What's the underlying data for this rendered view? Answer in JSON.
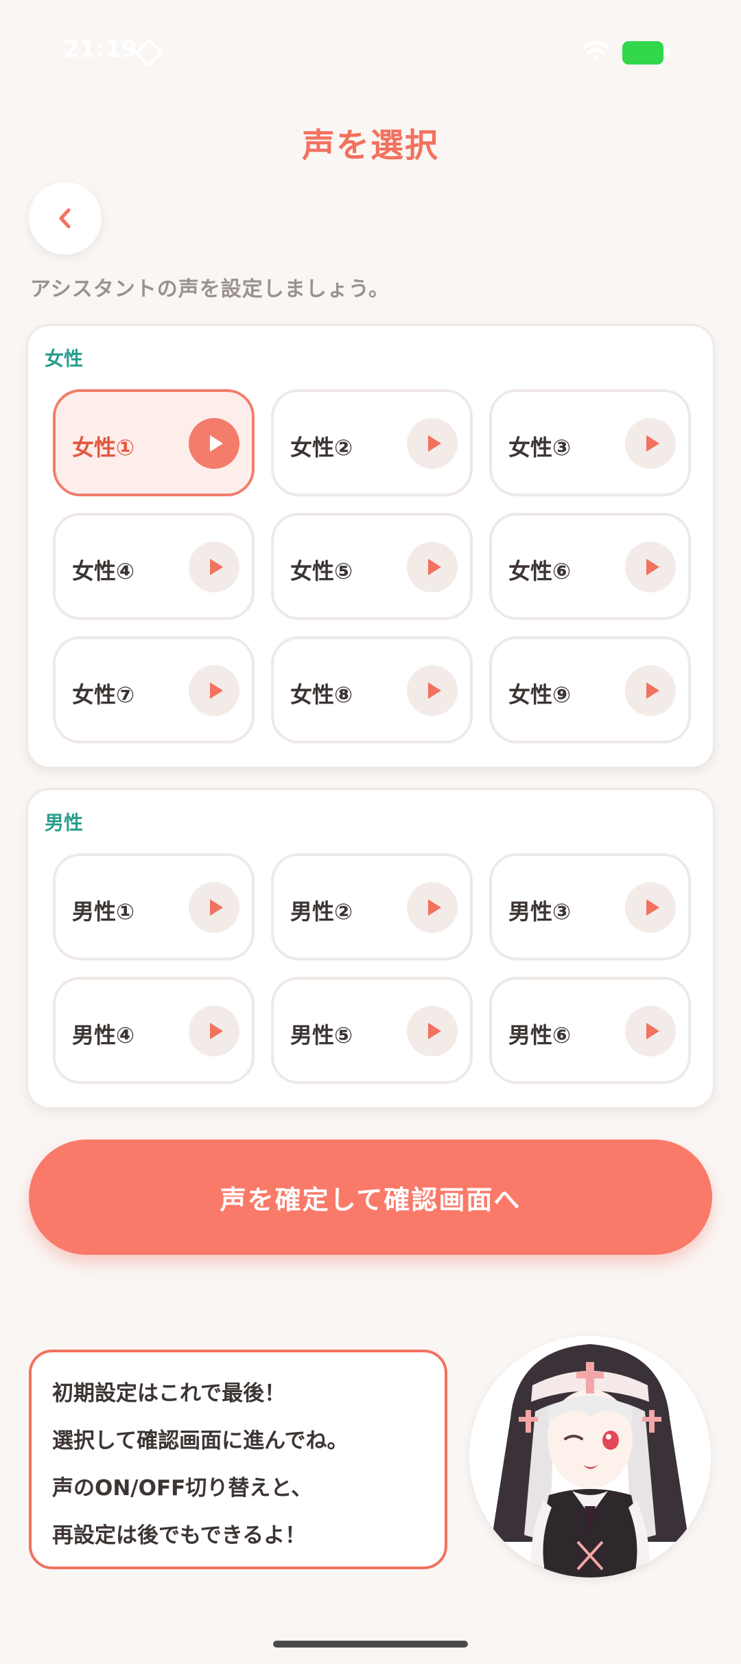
{
  "status_bar": {
    "time": "21:19"
  },
  "header": {
    "title": "声を選択",
    "subtitle": "アシスタントの声を設定しましょう。"
  },
  "female_section": {
    "label": "女性",
    "voices": [
      "女性①",
      "女性②",
      "女性③",
      "女性④",
      "女性⑤",
      "女性⑥",
      "女性⑦",
      "女性⑧",
      "女性⑨"
    ],
    "selected_index": 0
  },
  "male_section": {
    "label": "男性",
    "voices": [
      "男性①",
      "男性②",
      "男性③",
      "男性④",
      "男性⑤",
      "男性⑥"
    ]
  },
  "confirm_button": {
    "label": "声を確定して確認画面へ"
  },
  "speech_bubble": {
    "lines": [
      "初期設定はこれで最後！",
      "選択して確認画面に進んでね。",
      "声のON/OFF切り替えと、",
      "再設定は後でもできるよ！"
    ]
  },
  "colors": {
    "accent": "#f2715f",
    "section_label": "#2a9d8f",
    "background": "#faf6f4",
    "battery": "#32d74b"
  },
  "icons": {
    "back": "chevron-left-icon",
    "play": "play-icon"
  }
}
